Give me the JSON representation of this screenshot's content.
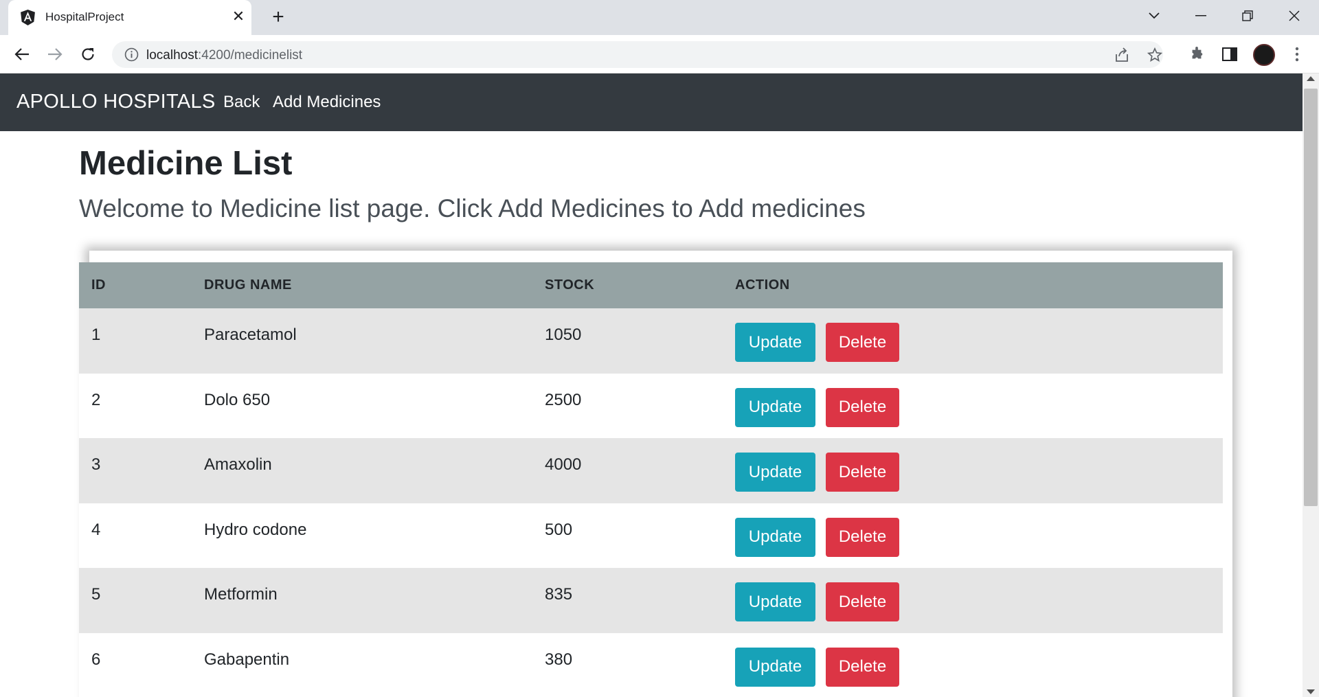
{
  "browser": {
    "tab_title": "HospitalProject",
    "favicon": "angular-icon",
    "url_host": "localhost",
    "url_path": ":4200/medicinelist"
  },
  "navbar": {
    "brand": "APOLLO HOSPITALS",
    "links": [
      "Back",
      "Add Medicines"
    ]
  },
  "page": {
    "title": "Medicine List",
    "lead": "Welcome to Medicine list page. Click Add Medicines to Add medicines"
  },
  "table": {
    "headers": [
      "ID",
      "DRUG NAME",
      "STOCK",
      "ACTION"
    ],
    "rows": [
      {
        "id": "1",
        "name": "Paracetamol",
        "stock": "1050"
      },
      {
        "id": "2",
        "name": "Dolo 650",
        "stock": "2500"
      },
      {
        "id": "3",
        "name": "Amaxolin",
        "stock": "4000"
      },
      {
        "id": "4",
        "name": "Hydro codone",
        "stock": "500"
      },
      {
        "id": "5",
        "name": "Metformin",
        "stock": "835"
      },
      {
        "id": "6",
        "name": "Gabapentin",
        "stock": "380"
      }
    ],
    "update_label": "Update",
    "delete_label": "Delete"
  },
  "colors": {
    "navbar_bg": "#343a40",
    "header_bg": "#95a3a4",
    "update_btn": "#17a2b8",
    "delete_btn": "#dc3545",
    "striped_row": "#e5e5e5"
  }
}
